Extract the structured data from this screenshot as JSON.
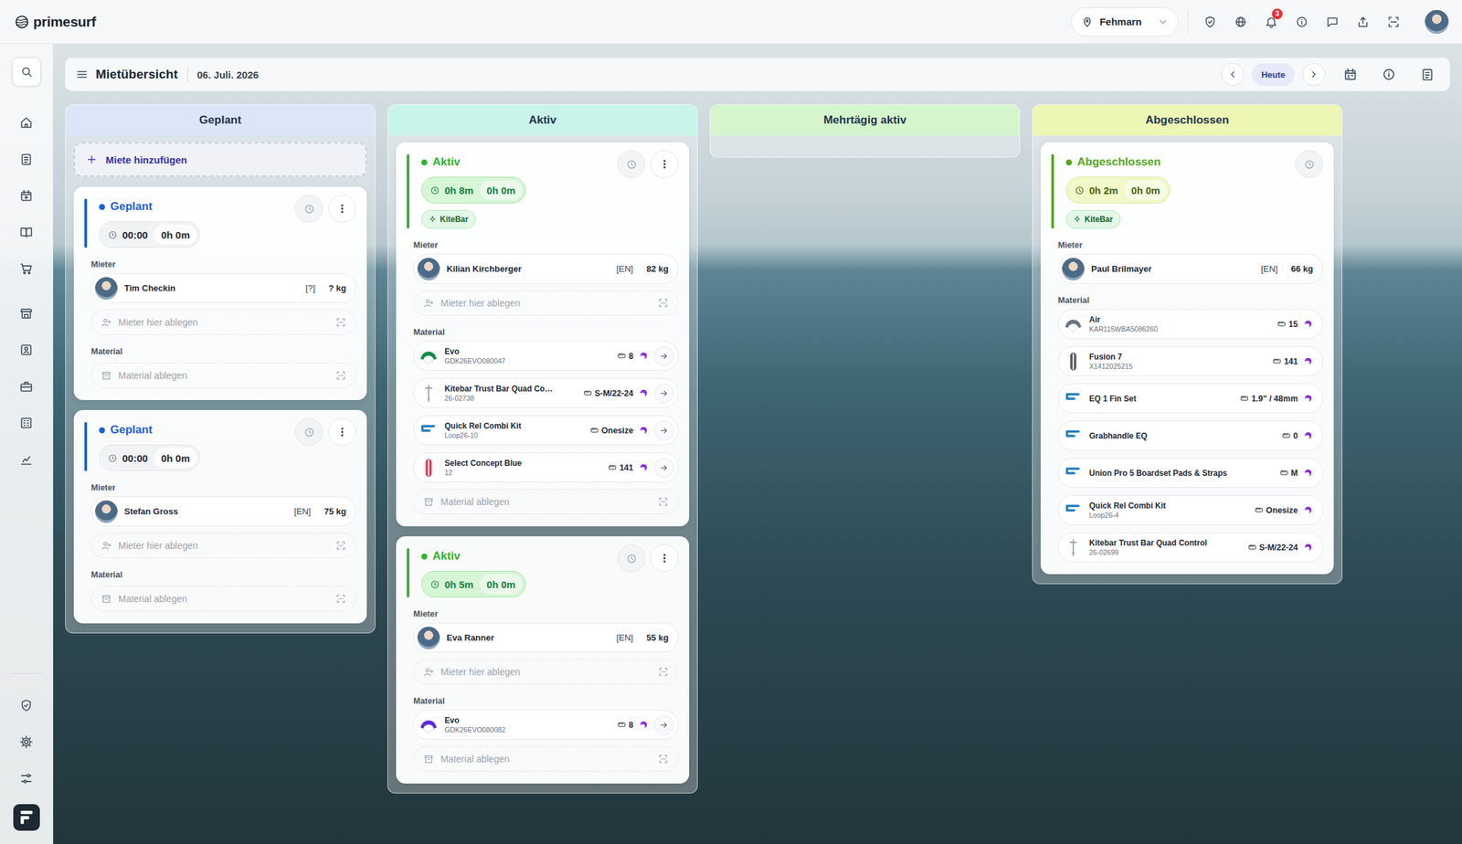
{
  "app": {
    "logo": "primesurf"
  },
  "topbar": {
    "location": "Fehmarn",
    "notification_count": "3"
  },
  "header": {
    "title": "Mietübersicht",
    "date": "06. Juli. 2026",
    "today_button": "Heute"
  },
  "columns": [
    {
      "title": "Geplant",
      "color": "#dbe7f8",
      "add_button": "Miete hinzufügen",
      "cards": [
        {
          "kind": "planned",
          "status": "Geplant",
          "color": "#1d5fd6",
          "time": "00:00",
          "duration": "0h 0m",
          "tags": [],
          "menu": true,
          "renter_label": "Mieter",
          "renter": {
            "name": "Tim Checkin",
            "lang": "[?]",
            "weight": "? kg"
          },
          "renter_drop": "Mieter hier ablegen",
          "material_label": "Material",
          "materials": [],
          "material_drop": "Material ablegen"
        },
        {
          "kind": "planned",
          "status": "Geplant",
          "color": "#1d5fd6",
          "time": "00:00",
          "duration": "0h 0m",
          "tags": [],
          "menu": true,
          "renter_label": "Mieter",
          "renter": {
            "name": "Stefan Gross",
            "lang": "[EN]",
            "weight": "75 kg"
          },
          "renter_drop": "Mieter hier ablegen",
          "material_label": "Material",
          "materials": [],
          "material_drop": "Material ablegen"
        }
      ]
    },
    {
      "title": "Aktiv",
      "color": "#c9f4ea",
      "cards": [
        {
          "kind": "active",
          "status": "Aktiv",
          "color": "#2fb52f",
          "time": "0h 8m",
          "duration": "0h 0m",
          "tags": [
            "KiteBar"
          ],
          "menu": true,
          "renter_label": "Mieter",
          "renter": {
            "name": "Kilian Kirchberger",
            "lang": "[EN]",
            "weight": "82 kg"
          },
          "renter_drop": "Mieter hier ablegen",
          "material_label": "Material",
          "materials": [
            {
              "kind": "kite",
              "name": "Evo",
              "code": "GDK26EVO080047",
              "size": "8",
              "color": "#178a48",
              "arrow": true
            },
            {
              "kind": "bar",
              "name": "Kitebar Trust Bar Quad Co…",
              "code": "26-02738",
              "size": "S-M/22-24",
              "color": "#9aa3ad",
              "arrow": true
            },
            {
              "kind": "accessory",
              "name": "Quick Rel Combi Kit",
              "code": "Loop26-10",
              "size": "Onesize",
              "color": "#1f7fc4",
              "arrow": true
            },
            {
              "kind": "board",
              "name": "Select Concept Blue",
              "code": "12",
              "size": "141",
              "color": "#d8455f",
              "arrow": true
            }
          ],
          "material_drop": "Material ablegen"
        },
        {
          "kind": "active",
          "status": "Aktiv",
          "color": "#2fb52f",
          "time": "0h 5m",
          "duration": "0h 0m",
          "tags": [],
          "menu": true,
          "renter_label": "Mieter",
          "renter": {
            "name": "Eva Ranner",
            "lang": "[EN]",
            "weight": "55 kg"
          },
          "renter_drop": "Mieter hier ablegen",
          "material_label": "Material",
          "materials": [
            {
              "kind": "kite",
              "name": "Evo",
              "code": "GDK26EVO080082",
              "size": "8",
              "color": "#5b2bd3",
              "arrow": true
            }
          ],
          "material_drop": "Material ablegen"
        }
      ]
    },
    {
      "title": "Mehrtägig aktiv",
      "color": "#d5f6cd",
      "cards": []
    },
    {
      "title": "Abgeschlossen",
      "color": "#eef6b6",
      "cards": [
        {
          "kind": "done",
          "status": "Abgeschlossen",
          "color": "#52a81e",
          "time": "0h 2m",
          "duration": "0h 0m",
          "tags": [
            "KiteBar"
          ],
          "menu": false,
          "renter_label": "Mieter",
          "renter": {
            "name": "Paul Brilmayer",
            "lang": "[EN]",
            "weight": "66 kg"
          },
          "material_label": "Material",
          "materials": [
            {
              "kind": "kite",
              "name": "Air",
              "code": "KAR115WBA5086260",
              "size": "15",
              "color": "#6b7280",
              "arrow": false
            },
            {
              "kind": "board",
              "name": "Fusion 7",
              "code": "X1412025215",
              "size": "141",
              "color": "#5b5f66",
              "arrow": false
            },
            {
              "kind": "accessory",
              "name": "EQ 1 Fin Set",
              "code": "",
              "size": "1.9\" / 48mm",
              "color": "#1f7fc4",
              "arrow": false
            },
            {
              "kind": "accessory",
              "name": "Grabhandle EQ",
              "code": "",
              "size": "0",
              "color": "#1f7fc4",
              "arrow": false
            },
            {
              "kind": "accessory",
              "name": "Union Pro 5 Boardset Pads & Straps",
              "code": "",
              "size": "M",
              "color": "#1f7fc4",
              "arrow": false
            },
            {
              "kind": "accessory",
              "name": "Quick Rel Combi Kit",
              "code": "Loop26-4",
              "size": "Onesize",
              "color": "#1f7fc4",
              "arrow": false
            },
            {
              "kind": "bar",
              "name": "Kitebar Trust Bar Quad Control",
              "code": "26-02699",
              "size": "S-M/22-24",
              "color": "#9aa3ad",
              "arrow": false
            }
          ]
        }
      ]
    }
  ]
}
